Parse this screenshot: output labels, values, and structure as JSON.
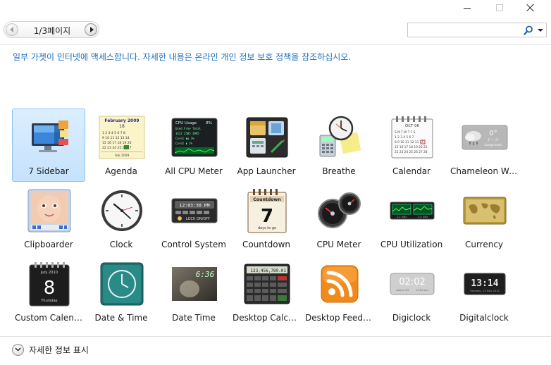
{
  "window": {
    "minimize_icon": "minimize-icon",
    "maximize_icon": "maximize-icon",
    "close_icon": "close-icon"
  },
  "toolbar": {
    "page_indicator": "1/3페이지",
    "search_placeholder": "",
    "search_value": ""
  },
  "notice": "일부 가젯이 인터넷에 액세스합니다. 자세한 내용은 온라인 개인 정보 보호 정책을 참조하십시오.",
  "gadgets": [
    {
      "label": "7 Sidebar",
      "icon": "sidebar-monitor-icon",
      "selected": true
    },
    {
      "label": "Agenda",
      "icon": "agenda-calendar-icon"
    },
    {
      "label": "All CPU Meter",
      "icon": "cpu-meter-icon"
    },
    {
      "label": "App Launcher",
      "icon": "app-launcher-icon"
    },
    {
      "label": "Breathe",
      "icon": "breathe-clock-icon"
    },
    {
      "label": "Calendar",
      "icon": "calendar-icon"
    },
    {
      "label": "Chameleon We...",
      "icon": "weather-icon"
    },
    {
      "label": "Clipboarder",
      "icon": "clipboarder-icon"
    },
    {
      "label": "Clock",
      "icon": "analog-clock-icon"
    },
    {
      "label": "Control System",
      "icon": "control-system-icon"
    },
    {
      "label": "Countdown",
      "icon": "countdown-icon"
    },
    {
      "label": "CPU Meter",
      "icon": "cpu-gauge-icon"
    },
    {
      "label": "CPU Utilization",
      "icon": "cpu-utilization-icon"
    },
    {
      "label": "Currency",
      "icon": "currency-map-icon"
    },
    {
      "label": "Custom Calendar",
      "icon": "custom-calendar-icon"
    },
    {
      "label": "Date & Time",
      "icon": "date-time-clock-icon"
    },
    {
      "label": "Date Time",
      "icon": "date-time-photo-icon"
    },
    {
      "label": "Desktop Calcul...",
      "icon": "calculator-icon"
    },
    {
      "label": "Desktop Feed R...",
      "icon": "rss-feed-icon"
    },
    {
      "label": "Digiclock",
      "icon": "digiclock-icon"
    },
    {
      "label": "Digitalclock",
      "icon": "digitalclock-icon"
    }
  ],
  "icon_text": {
    "agenda_month": "February 2009",
    "agenda_day": "18",
    "cpu_title": "CPU Usage",
    "cpu_pct": "8%",
    "control_time": "12:03:30 PM",
    "control_lock": "LOCK ON/OFF",
    "countdown_title": "Countdown",
    "countdown_num": "7",
    "countdown_sub": "days to go",
    "calendar_month": "OCT 06",
    "weather_temp": "0°",
    "custom_cal_month": "July 2010",
    "custom_cal_day": "8",
    "custom_cal_weekday": "Thursday",
    "date_time_digits": "6:36",
    "calc_display": "123,456,789.01",
    "digiclock_time": "02:02",
    "digitalclock_time": "13:14"
  },
  "footer": {
    "details_label": "자세한 정보 표시"
  },
  "colors": {
    "notice_blue": "#1c6fc0",
    "selection_bg": "#c6e2fc",
    "selection_border": "#8fc3f2"
  }
}
